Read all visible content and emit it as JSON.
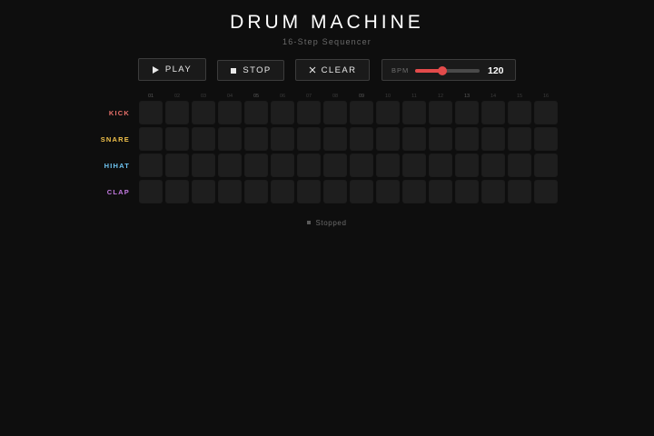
{
  "app": {
    "title": "DRUM MACHINE",
    "subtitle": "16-Step Sequencer"
  },
  "transport": {
    "play_label": "PLAY",
    "stop_label": "STOP",
    "clear_label": "CLEAR",
    "play_icon": "play-icon",
    "stop_icon": "stop-icon",
    "clear_icon": "close-icon"
  },
  "bpm": {
    "label": "BPM",
    "value": "120",
    "slider_fraction": 0.42
  },
  "sequencer": {
    "step_numbers": [
      "01",
      "02",
      "03",
      "04",
      "05",
      "06",
      "07",
      "08",
      "09",
      "10",
      "11",
      "12",
      "13",
      "14",
      "15",
      "16"
    ],
    "tracks": [
      {
        "name": "KICK",
        "color": "#e8706a",
        "steps": [
          0,
          0,
          0,
          0,
          0,
          0,
          0,
          0,
          0,
          0,
          0,
          0,
          0,
          0,
          0,
          0
        ]
      },
      {
        "name": "SNARE",
        "color": "#f0c14a",
        "steps": [
          0,
          0,
          0,
          0,
          0,
          0,
          0,
          0,
          0,
          0,
          0,
          0,
          0,
          0,
          0,
          0
        ]
      },
      {
        "name": "HIHAT",
        "color": "#6ec3f0",
        "steps": [
          0,
          0,
          0,
          0,
          0,
          0,
          0,
          0,
          0,
          0,
          0,
          0,
          0,
          0,
          0,
          0
        ]
      },
      {
        "name": "CLAP",
        "color": "#c27ae0",
        "steps": [
          0,
          0,
          0,
          0,
          0,
          0,
          0,
          0,
          0,
          0,
          0,
          0,
          0,
          0,
          0,
          0
        ]
      }
    ]
  },
  "status": {
    "text": "Stopped"
  },
  "colors": {
    "background": "#0e0e0e",
    "accent": "#e34b4b",
    "pad": "#1e1e1e"
  }
}
